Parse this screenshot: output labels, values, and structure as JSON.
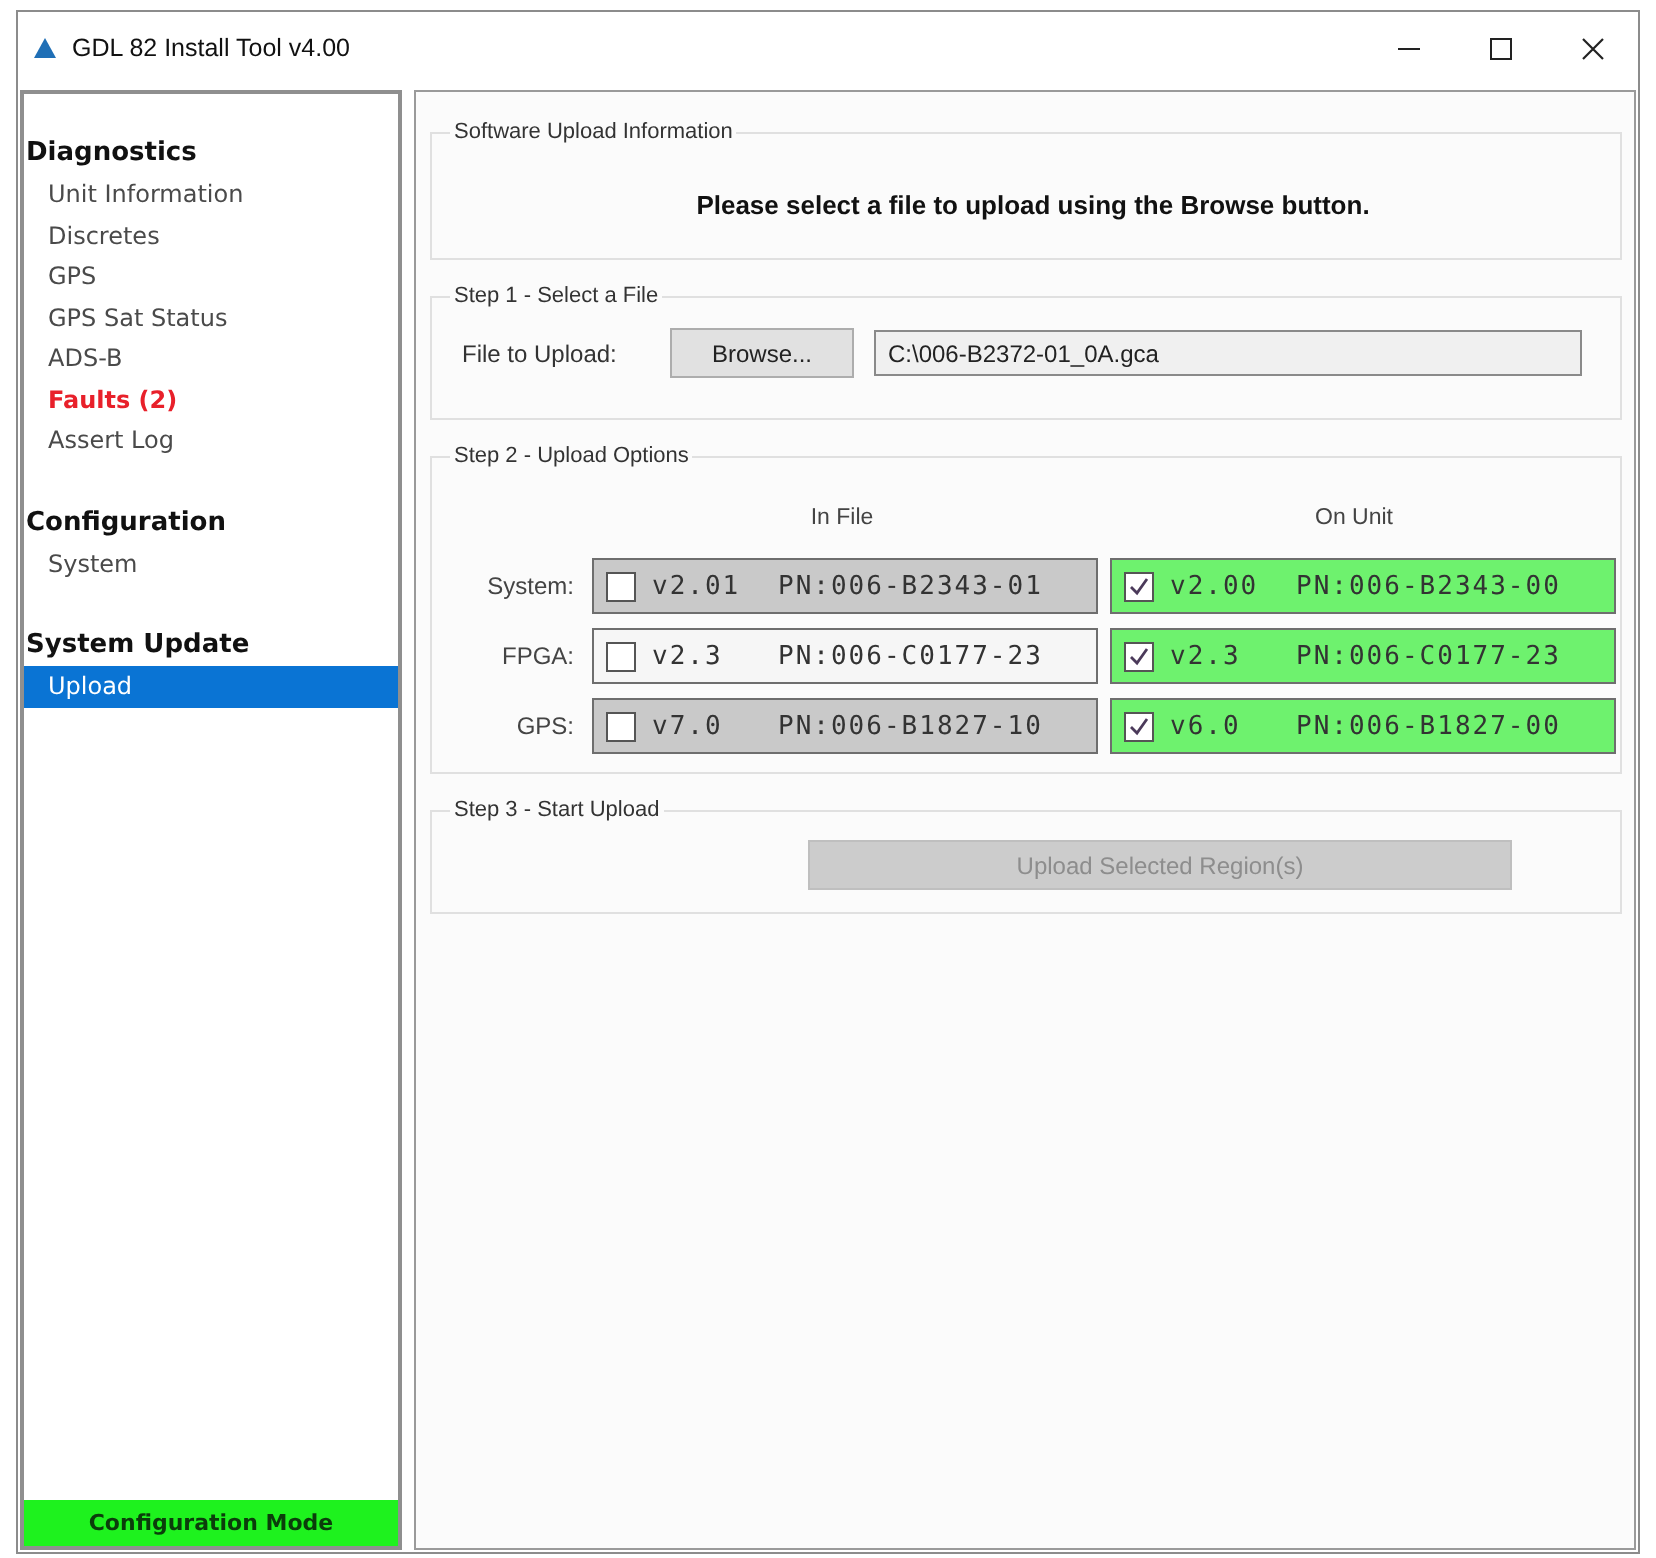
{
  "window": {
    "title": "GDL 82 Install Tool v4.00"
  },
  "sidebar": {
    "sections": [
      {
        "title": "Diagnostics",
        "items": [
          {
            "label": "Unit Information",
            "selected": false,
            "warning": false
          },
          {
            "label": "Discretes",
            "selected": false,
            "warning": false
          },
          {
            "label": "GPS",
            "selected": false,
            "warning": false
          },
          {
            "label": "GPS Sat Status",
            "selected": false,
            "warning": false
          },
          {
            "label": "ADS-B",
            "selected": false,
            "warning": false
          },
          {
            "label": "Faults (2)",
            "selected": false,
            "warning": true
          },
          {
            "label": "Assert Log",
            "selected": false,
            "warning": false
          }
        ]
      },
      {
        "title": "Configuration",
        "items": [
          {
            "label": "System",
            "selected": false,
            "warning": false
          }
        ]
      },
      {
        "title": "System Update",
        "items": [
          {
            "label": "Upload",
            "selected": true,
            "warning": false
          }
        ]
      }
    ],
    "status": "Configuration Mode"
  },
  "info": {
    "title": "Software Upload Information",
    "message": "Please select a file to upload using the Browse button."
  },
  "step1": {
    "title": "Step 1 - Select a File",
    "label": "File to Upload:",
    "browse_button": "Browse...",
    "file_path": "C:\\006-B2372-01_0A.gca"
  },
  "step2": {
    "title": "Step 2 - Upload Options",
    "columns": [
      "In File",
      "On Unit"
    ],
    "rows": [
      {
        "label": "System:",
        "in_file": {
          "version": "v2.01",
          "part_number": "PN:006-B2343-01",
          "checked": false,
          "color": "#c9c9c9"
        },
        "on_unit": {
          "version": "v2.00",
          "part_number": "PN:006-B2343-00",
          "checked": true,
          "color": "#6ef26e"
        }
      },
      {
        "label": "FPGA:",
        "in_file": {
          "version": "v2.3",
          "part_number": "PN:006-C0177-23",
          "checked": false,
          "color": "#f6f6f6"
        },
        "on_unit": {
          "version": "v2.3",
          "part_number": "PN:006-C0177-23",
          "checked": true,
          "color": "#6ef26e"
        }
      },
      {
        "label": "GPS:",
        "in_file": {
          "version": "v7.0",
          "part_number": "PN:006-B1827-10",
          "checked": false,
          "color": "#c9c9c9"
        },
        "on_unit": {
          "version": "v6.0",
          "part_number": "PN:006-B1827-00",
          "checked": true,
          "color": "#6ef26e"
        }
      }
    ]
  },
  "step3": {
    "title": "Step 3 - Start Upload",
    "button": {
      "label": "Upload Selected Region(s)",
      "disabled": true
    }
  }
}
